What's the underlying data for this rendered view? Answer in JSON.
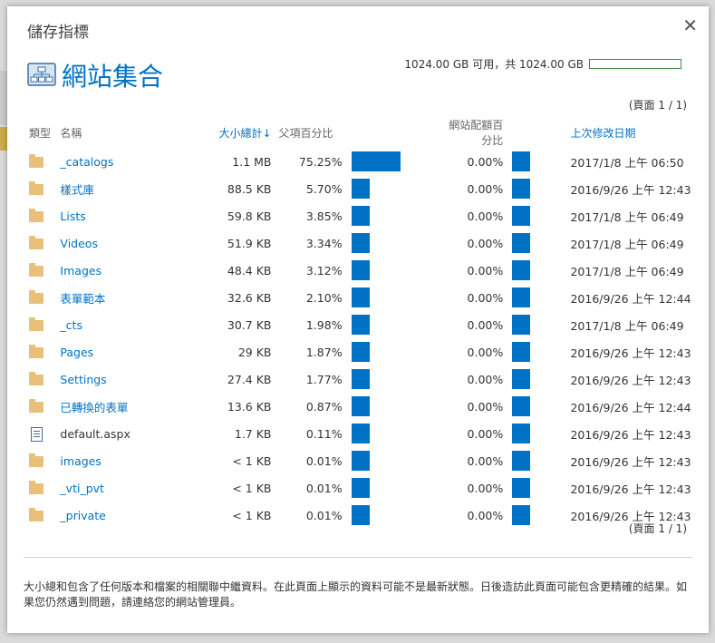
{
  "dialog": {
    "title": "儲存指標",
    "close_icon": "close-icon",
    "site_title": "網站集合",
    "storage_text": "1024.00 GB 可用，共 1024.00 GB",
    "storage_used_fraction": 0.0,
    "paging_top": "(頁面 1 / 1)",
    "paging_bottom": "(頁面 1 / 1)",
    "footer": "大小總和包含了任何版本和檔案的相關聯中繼資料。在此頁面上顯示的資料可能不是最新狀態。日後造訪此頁面可能包含更精確的結果。如果您仍然遇到問題，請連絡您的網站管理員。"
  },
  "columns": {
    "type": "類型",
    "name": "名稱",
    "size": "大小總計↓",
    "parent_pct": "父項百分比",
    "quota_pct": "網站配額百分比",
    "modified": "上次修改日期"
  },
  "colors": {
    "accent": "#0072c6",
    "folder": "#e8c077",
    "storage_border": "#3c8a3c"
  },
  "rows": [
    {
      "type": "folder",
      "name": "_catalogs",
      "size": "1.1 MB",
      "pct": "75.25%",
      "pct_value": 75.25,
      "quota": "0.00%",
      "date": "2017/1/8 上午 06:50"
    },
    {
      "type": "folder",
      "name": "樣式庫",
      "size": "88.5 KB",
      "pct": "5.70%",
      "pct_value": 5.7,
      "quota": "0.00%",
      "date": "2016/9/26 上午 12:43"
    },
    {
      "type": "folder",
      "name": "Lists",
      "size": "59.8 KB",
      "pct": "3.85%",
      "pct_value": 3.85,
      "quota": "0.00%",
      "date": "2017/1/8 上午 06:49"
    },
    {
      "type": "folder",
      "name": "Videos",
      "size": "51.9 KB",
      "pct": "3.34%",
      "pct_value": 3.34,
      "quota": "0.00%",
      "date": "2017/1/8 上午 06:49"
    },
    {
      "type": "folder",
      "name": "Images",
      "size": "48.4 KB",
      "pct": "3.12%",
      "pct_value": 3.12,
      "quota": "0.00%",
      "date": "2017/1/8 上午 06:49"
    },
    {
      "type": "folder",
      "name": "表單範本",
      "size": "32.6 KB",
      "pct": "2.10%",
      "pct_value": 2.1,
      "quota": "0.00%",
      "date": "2016/9/26 上午 12:44"
    },
    {
      "type": "folder",
      "name": "_cts",
      "size": "30.7 KB",
      "pct": "1.98%",
      "pct_value": 1.98,
      "quota": "0.00%",
      "date": "2017/1/8 上午 06:49"
    },
    {
      "type": "folder",
      "name": "Pages",
      "size": "29 KB",
      "pct": "1.87%",
      "pct_value": 1.87,
      "quota": "0.00%",
      "date": "2016/9/26 上午 12:43"
    },
    {
      "type": "folder",
      "name": "Settings",
      "size": "27.4 KB",
      "pct": "1.77%",
      "pct_value": 1.77,
      "quota": "0.00%",
      "date": "2016/9/26 上午 12:43"
    },
    {
      "type": "folder",
      "name": "已轉換的表單",
      "size": "13.6 KB",
      "pct": "0.87%",
      "pct_value": 0.87,
      "quota": "0.00%",
      "date": "2016/9/26 上午 12:44"
    },
    {
      "type": "file",
      "name": "default.aspx",
      "size": "1.7 KB",
      "pct": "0.11%",
      "pct_value": 0.11,
      "quota": "0.00%",
      "date": "2016/9/26 上午 12:43"
    },
    {
      "type": "folder",
      "name": "images",
      "size": "< 1 KB",
      "pct": "0.01%",
      "pct_value": 0.01,
      "quota": "0.00%",
      "date": "2016/9/26 上午 12:43"
    },
    {
      "type": "folder",
      "name": "_vti_pvt",
      "size": "< 1 KB",
      "pct": "0.01%",
      "pct_value": 0.01,
      "quota": "0.00%",
      "date": "2016/9/26 上午 12:43"
    },
    {
      "type": "folder",
      "name": "_private",
      "size": "< 1 KB",
      "pct": "0.01%",
      "pct_value": 0.01,
      "quota": "0.00%",
      "date": "2016/9/26 上午 12:43"
    }
  ]
}
